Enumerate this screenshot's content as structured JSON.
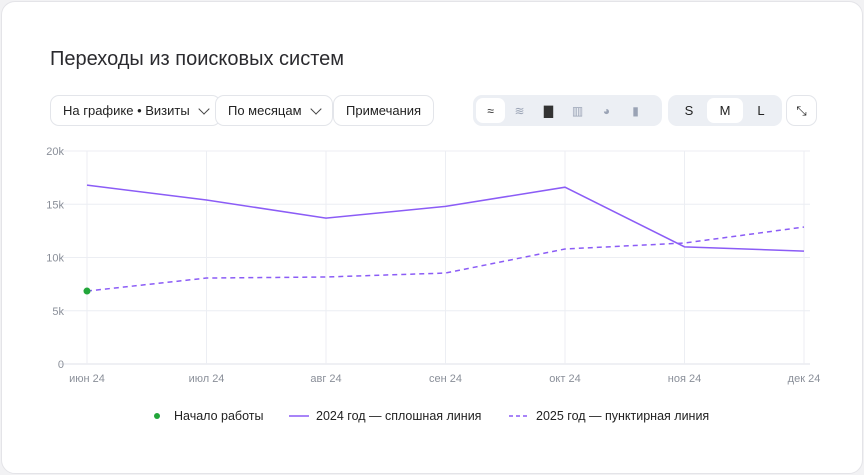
{
  "title": "Переходы из поисковых систем",
  "controls": {
    "metric": "На графике • Визиты",
    "period": "По месяцам",
    "notes": "Примечания",
    "chart_types": [
      "line-chart-icon",
      "area-chart-icon",
      "bar-chart-icon",
      "stacked-bar-icon",
      "pie-chart-icon",
      "column-chart-icon"
    ],
    "sizes": [
      "S",
      "M",
      "L"
    ],
    "selected_size": "M",
    "collapse": "collapse-icon"
  },
  "chart_data": {
    "type": "line",
    "categories": [
      "июн 24",
      "июл 24",
      "авг 24",
      "сен 24",
      "окт 24",
      "ноя 24",
      "дек 24"
    ],
    "yticks": [
      "0",
      "5k",
      "10k",
      "15k",
      "20k"
    ],
    "ylim": [
      0,
      20000
    ],
    "grid": true,
    "legend_placement": "bottom",
    "series": [
      {
        "name": "2024 год — сплошная линия",
        "style": "solid",
        "color": "#8b5cf6",
        "values": [
          16800,
          15400,
          13700,
          14800,
          16600,
          11000,
          10600
        ]
      },
      {
        "name": "2025 год — пунктирная линия",
        "style": "dashed",
        "color": "#8b5cf6",
        "values": [
          6850,
          8070,
          8170,
          8540,
          10800,
          11360,
          12860
        ]
      }
    ],
    "marker": {
      "name": "Начало работы",
      "category": "июн 24",
      "value": 6850,
      "color": "#22a63a"
    }
  }
}
